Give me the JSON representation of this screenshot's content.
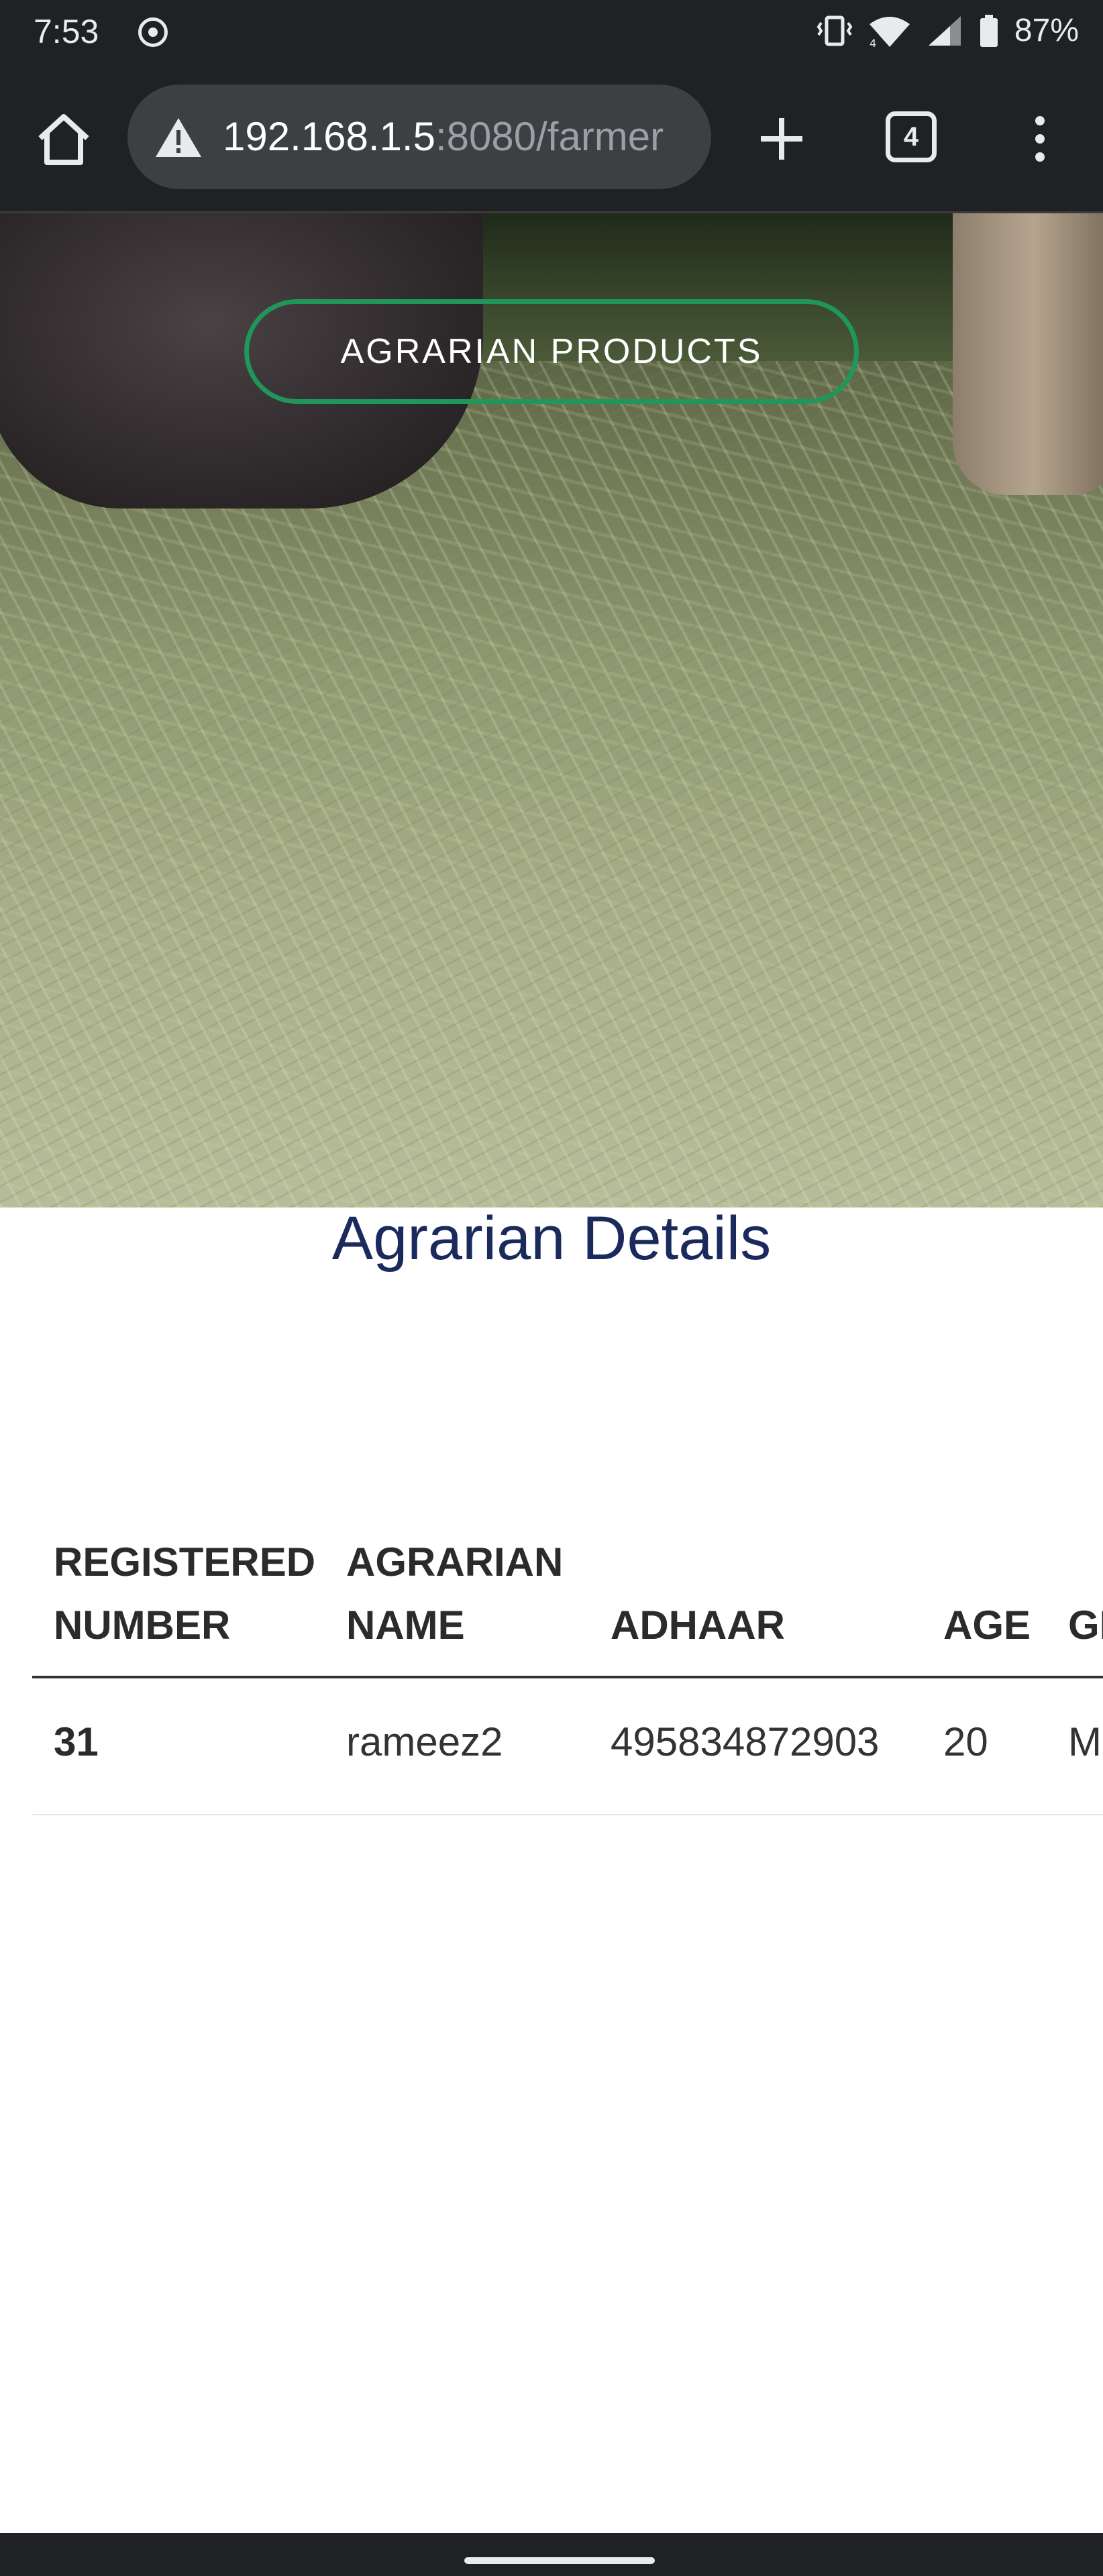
{
  "status_bar": {
    "time": "7:53",
    "battery": "87%",
    "network_type": "4"
  },
  "browser": {
    "url_host": "192.168.1.5",
    "url_rest": ":8080/farmer",
    "tab_count": "4"
  },
  "hero": {
    "button_label": "AGRARIAN PRODUCTS",
    "button_color": "#21965a"
  },
  "page": {
    "title": "Agrarian Details",
    "title_color": "#1b2a5c"
  },
  "table": {
    "columns": [
      {
        "line1": "REGISTERED",
        "line2": "NUMBER"
      },
      {
        "line1": "AGRARIAN",
        "line2": "NAME"
      },
      {
        "line1": "",
        "line2": "ADHAAR"
      },
      {
        "line1": "",
        "line2": "AGE"
      },
      {
        "line1": "",
        "line2": "GE"
      }
    ],
    "rows": [
      {
        "registered_number": "31",
        "name": "rameez2",
        "adhaar": "495834872903",
        "age": "20",
        "gender": "M"
      }
    ]
  }
}
